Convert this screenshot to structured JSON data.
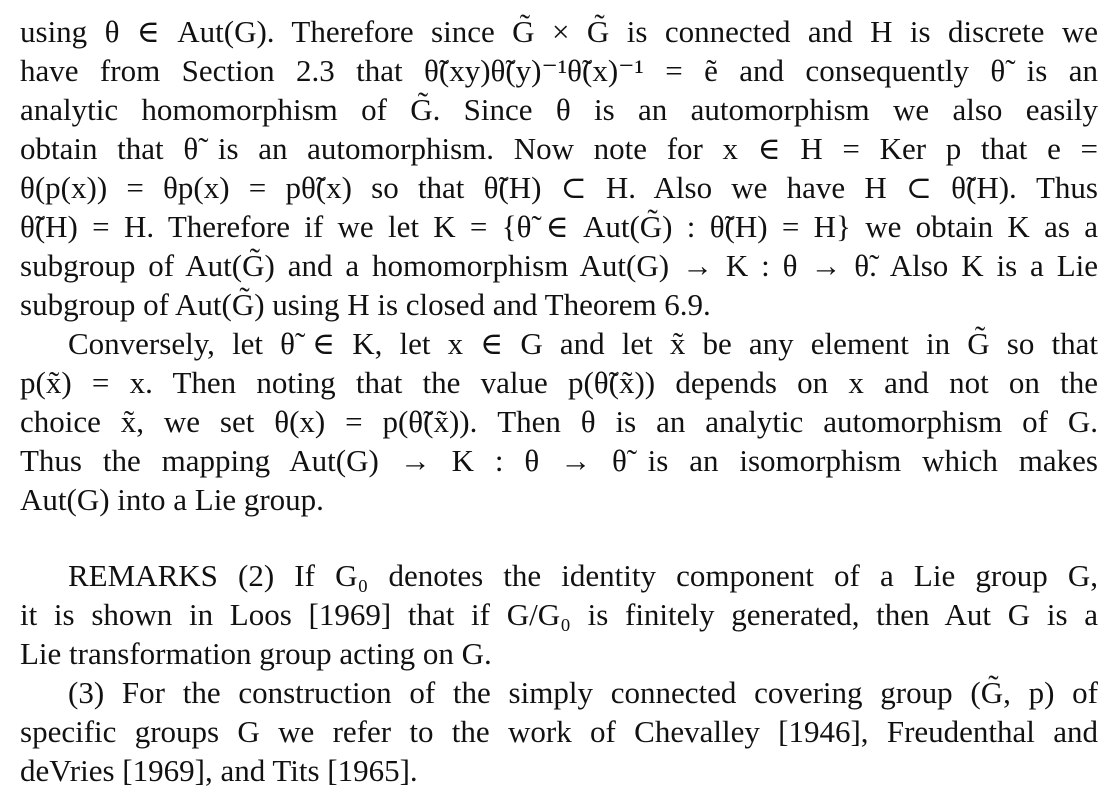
{
  "paragraphs": [
    {
      "id": "proof-part-1",
      "lines": [
        "using θ ∈ Aut(G). Therefore since G̃ × G̃ is connected and H is discrete we",
        "have from Section 2.3 that θ̃(xy)θ̃(y)⁻¹θ̃(x)⁻¹ = ẽ and consequently θ̃ is an",
        "analytic homomorphism of G̃. Since θ is an automorphism we also easily",
        "obtain that θ̃ is an automorphism. Now note for x ∈ H = Ker p that e =",
        "θ(p(x)) = θp(x) = pθ̃(x) so that θ̃(H) ⊂ H. Also we have H ⊂ θ̃(H). Thus",
        "θ̃(H) = H. Therefore if we let K = {θ̃ ∈ Aut(G̃) : θ̃(H) = H} we obtain K as a",
        "subgroup of Aut(G̃) and a homomorphism Aut(G) → K : θ → θ̃. Also K is a Lie",
        "subgroup of Aut(G̃) using H is closed and Theorem 6.9."
      ]
    },
    {
      "id": "proof-part-2",
      "lines": [
        "Conversely, let θ̃ ∈ K, let x ∈ G and let x̃ be any element in G̃ so that",
        "p(x̃) = x. Then noting that the value p(θ̃(x̃)) depends on x and not on the",
        "choice x̃, we set θ(x) = p(θ̃(x̃)). Then θ is an analytic automorphism of G.",
        "Thus the mapping Aut(G) → K : θ → θ̃ is an isomorphism which makes",
        "Aut(G) into a Lie group."
      ]
    },
    {
      "id": "remark-2",
      "lines": [
        "REMARKS (2) If G₀ denotes the identity component of a Lie group G,",
        "it is shown in Loos [1969] that if G/G₀ is finitely generated, then Aut G is a",
        "Lie transformation group acting on G."
      ]
    },
    {
      "id": "remark-3",
      "lines": [
        "(3) For the construction of the simply connected covering group (G̃, p) of",
        "specific groups G we refer to the work of Chevalley [1946], Freudenthal and",
        "deVries [1969], and Tits [1965]."
      ]
    }
  ]
}
